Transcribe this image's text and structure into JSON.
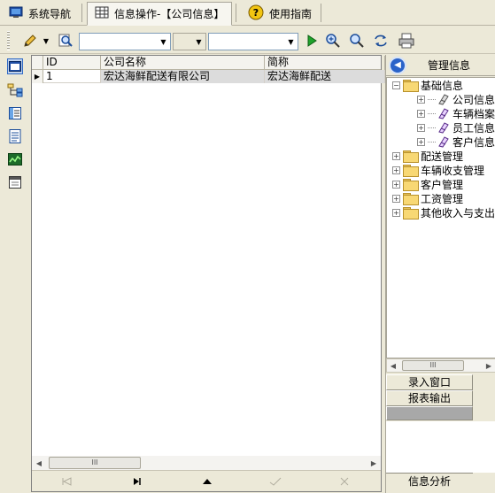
{
  "tabs": [
    {
      "label": "系统导航",
      "icon": "monitor-icon"
    },
    {
      "label": "信息操作-【公司信息】",
      "icon": "grid-icon"
    },
    {
      "label": "使用指南",
      "icon": "help-icon"
    }
  ],
  "toolbar": {
    "combo1_value": "",
    "combo2_value": "",
    "combo3_value": "",
    "icons": [
      "pencil-icon",
      "search-document-icon",
      "run-icon",
      "zoom-in-icon",
      "zoom-icon",
      "refresh-icon",
      "print-icon"
    ]
  },
  "left_icons": [
    "window-icon",
    "hierarchy-icon",
    "list-icon",
    "document-icon",
    "chart-icon",
    "calendar-icon"
  ],
  "grid": {
    "columns": [
      "ID",
      "公司名称",
      "简称"
    ],
    "rows": [
      {
        "id": "1",
        "name": "宏达海鲜配送有限公司",
        "short": "宏达海鲜配送"
      }
    ],
    "scroll_thumb_label": "III"
  },
  "navbar": {
    "buttons": [
      "first-record-button",
      "next-record-button",
      "prev-record-button",
      "post-button",
      "cancel-button"
    ]
  },
  "right_panel": {
    "title": "管理信息",
    "tree": [
      {
        "label": "基础信息",
        "level": 0,
        "expanded": true,
        "type": "folder"
      },
      {
        "label": "公司信息",
        "level": 1,
        "type": "leaf"
      },
      {
        "label": "车辆档案",
        "level": 1,
        "type": "leaf"
      },
      {
        "label": "员工信息",
        "level": 1,
        "type": "leaf"
      },
      {
        "label": "客户信息",
        "level": 1,
        "type": "leaf"
      },
      {
        "label": "配送管理",
        "level": 0,
        "type": "folder"
      },
      {
        "label": "车辆收支管理",
        "level": 0,
        "type": "folder"
      },
      {
        "label": "客户管理",
        "level": 0,
        "type": "folder"
      },
      {
        "label": "工资管理",
        "level": 0,
        "type": "folder"
      },
      {
        "label": "其他收入与支出",
        "level": 0,
        "type": "folder"
      }
    ],
    "scroll_thumb_label": "III",
    "buttons": [
      "录入窗口",
      "报表输出"
    ],
    "bottom_label": "信息分析"
  }
}
